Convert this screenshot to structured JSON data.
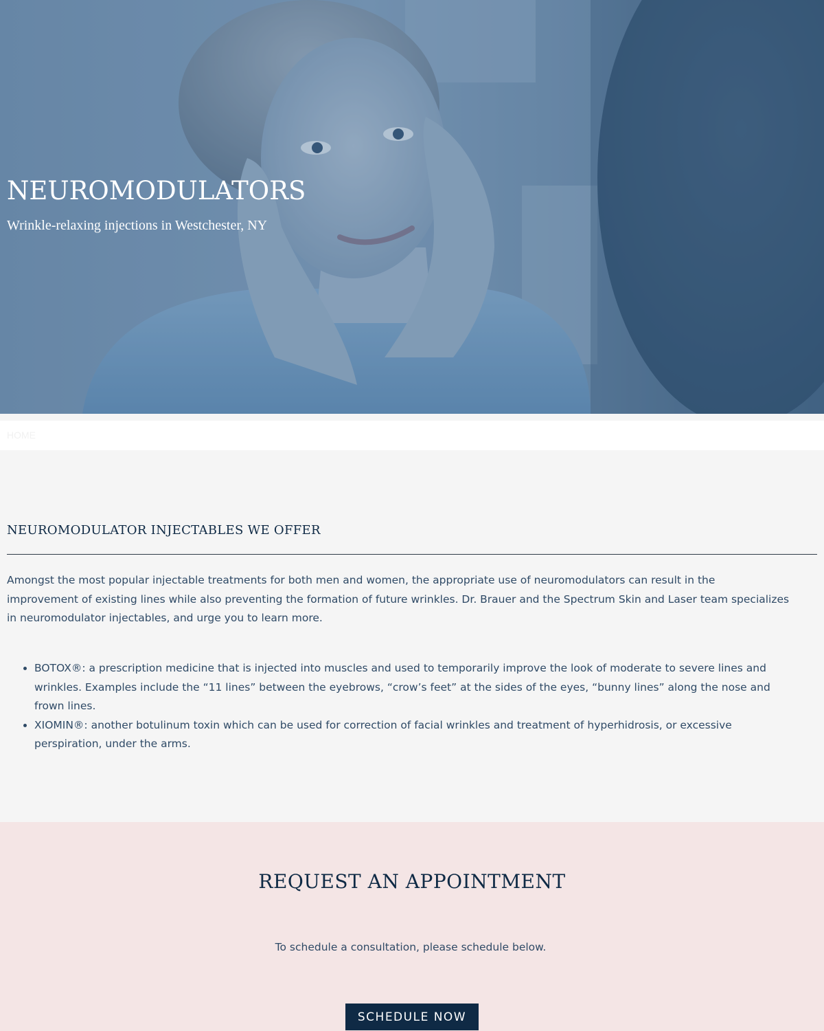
{
  "hero": {
    "title": "NEUROMODULATORS",
    "subtitle": "Wrinkle-relaxing injections in Westchester, NY",
    "image_alt": "woman-touching-face-in-mirror-photo"
  },
  "breadcrumb": {
    "home_label": "HOME"
  },
  "offerings": {
    "heading": "NEUROMODULATOR INJECTABLES WE OFFER",
    "intro": "Amongst the most popular injectable treatments for both men and women, the appropriate use of neuromodulators can result in the improvement of existing lines while also preventing the formation of future wrinkles. Dr. Brauer and the Spectrum Skin and Laser team specializes in neuromodulator injectables, and urge you to learn more.",
    "items": [
      {
        "text": "BOTOX®: a prescription medicine that is injected into muscles and used to temporarily improve the look of moderate to severe lines and wrinkles. Examples include the “11 lines” between the eyebrows, “crow’s feet” at the sides of the eyes, “bunny lines” along the nose and frown lines."
      },
      {
        "text": "XIOMIN®: another botulinum toxin which can be used for correction of facial wrinkles and treatment of hyperhidrosis, or excessive perspiration, under the arms."
      }
    ]
  },
  "appointment": {
    "title": "REQUEST AN APPOINTMENT",
    "text": "To schedule a consultation, please schedule below.",
    "button_label": "SCHEDULE NOW"
  },
  "colors": {
    "navy": "#0f2a45",
    "body_text": "#2f4a66",
    "page_bg": "#f5f5f5",
    "appointment_bg": "#f4e5e5",
    "hero_overlay": "#28527d"
  }
}
